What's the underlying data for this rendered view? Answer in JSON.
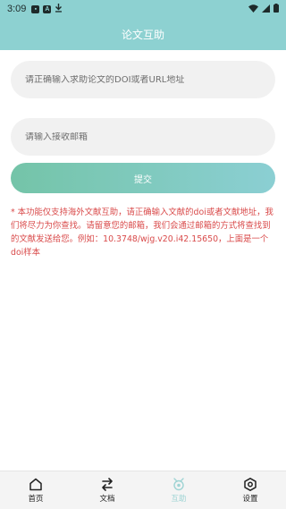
{
  "status_bar": {
    "time": "3:09",
    "left_icons": [
      "photo-icon",
      "a-icon",
      "download-icon"
    ],
    "right_icons": [
      "wifi-icon",
      "signal-icon",
      "battery-icon"
    ]
  },
  "header": {
    "title": "论文互助"
  },
  "form": {
    "doi_placeholder": "请正确输入求助论文的DOI或者URL地址",
    "doi_value": "",
    "email_placeholder": "请输入接收邮箱",
    "email_value": "",
    "submit_label": "提交"
  },
  "notice": "* 本功能仅支持海外文献互助，请正确输入文献的doi或者文献地址，我们将尽力为你查找。请留意您的邮箱，我们会通过邮箱的方式将查找到的文献发送给您。例如：10.3748/wjg.v20.i42.15650，上面是一个doi样本",
  "tabs": [
    {
      "label": "首页",
      "icon": "home-icon",
      "active": false
    },
    {
      "label": "文档",
      "icon": "swap-icon",
      "active": false
    },
    {
      "label": "互助",
      "icon": "help-icon",
      "active": true
    },
    {
      "label": "设置",
      "icon": "gear-icon",
      "active": false
    }
  ],
  "colors": {
    "accent": "#8dd1d1",
    "notice": "#d94a4a"
  }
}
